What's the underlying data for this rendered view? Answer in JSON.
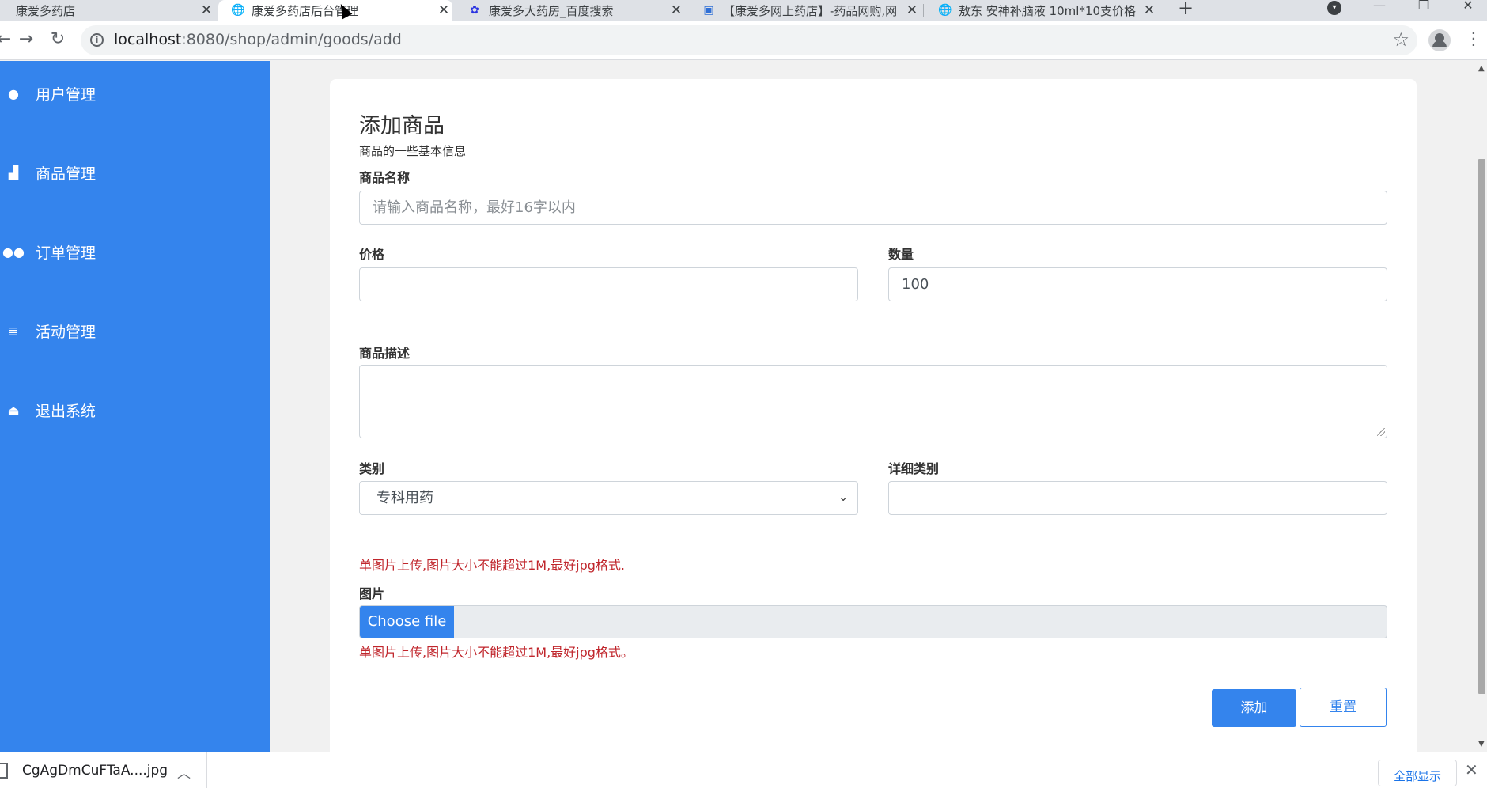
{
  "browser": {
    "tabs": [
      {
        "title": "康爱多药店",
        "favicon": "globe-icon"
      },
      {
        "title": "康爱多药店后台管理",
        "favicon": "globe-icon",
        "active": true
      },
      {
        "title": "康爱多大药房_百度搜索",
        "favicon": "baidu-paw-icon"
      },
      {
        "title": "【康爱多网上药店】-药品网购,网",
        "favicon": "page-icon"
      },
      {
        "title": "敖东 安神补脑液 10ml*10支价格",
        "favicon": "globe-icon"
      }
    ],
    "tab_close_glyph": "✕",
    "new_tab_glyph": "+",
    "url_host": "localhost",
    "url_path": ":8080/shop/admin/goods/add",
    "accent_color": "#3484ed"
  },
  "sidebar": {
    "items": [
      {
        "label": "用户管理",
        "icon": "user-icon"
      },
      {
        "label": "商品管理",
        "icon": "bar-chart-icon"
      },
      {
        "label": "订单管理",
        "icon": "users-icon"
      },
      {
        "label": "活动管理",
        "icon": "database-icon"
      },
      {
        "label": "退出系统",
        "icon": "eject-icon"
      }
    ]
  },
  "form": {
    "title": "添加商品",
    "subtitle": "商品的一些基本信息",
    "name_label": "商品名称",
    "name_placeholder": "请输入商品名称，最好16字以内",
    "price_label": "价格",
    "price_value": "",
    "quantity_label": "数量",
    "quantity_value": "100",
    "description_label": "商品描述",
    "category_label": "类别",
    "category_value": "专科用药",
    "detail_category_label": "详细类别",
    "detail_category_value": "",
    "image_hint_top": "单图片上传,图片大小不能超过1M,最好jpg格式.",
    "image_label": "图片",
    "choose_file_label": "Choose file",
    "image_hint_bottom": "单图片上传,图片大小不能超过1M,最好jpg格式。",
    "submit_label": "添加",
    "reset_label": "重置",
    "hint_color": "#c0262c"
  },
  "downloads": {
    "file_name": "CgAgDmCuFTaA....jpg",
    "show_all_label": "全部显示"
  }
}
